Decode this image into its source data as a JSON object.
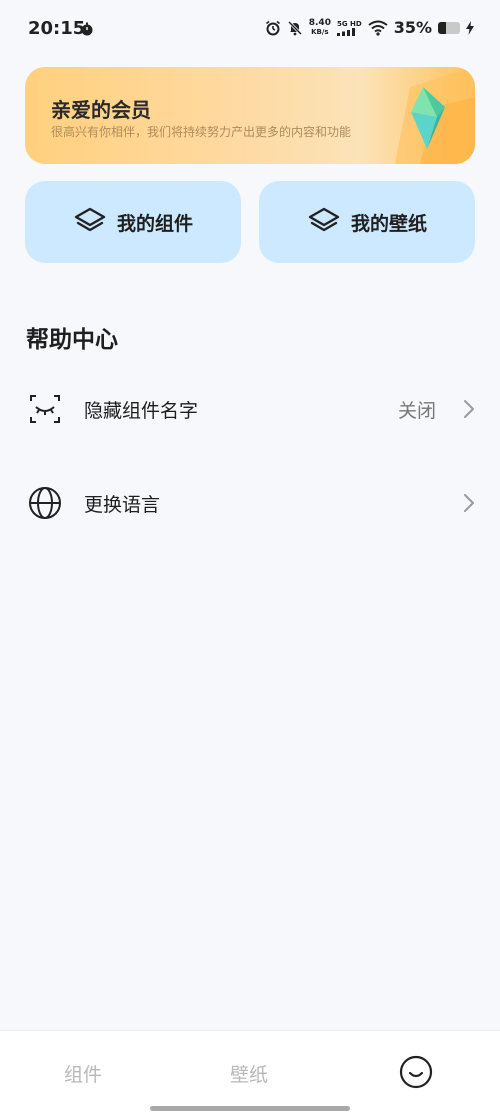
{
  "status_bar": {
    "time": "20:15",
    "net_speed_value": "8.40",
    "net_speed_unit": "KB/s",
    "network_type": "5G HD",
    "battery_text": "35%",
    "battery_level": 0.35
  },
  "banner": {
    "title": "亲爱的会员",
    "subtitle": "很高兴有你相伴，我们将持续努力产出更多的内容和功能"
  },
  "shortcuts": [
    {
      "label": "我的组件",
      "icon": "layers-icon"
    },
    {
      "label": "我的壁纸",
      "icon": "layers-icon"
    }
  ],
  "help_center": {
    "title": "帮助中心",
    "items": [
      {
        "label": "隐藏组件名字",
        "value": "关闭",
        "icon": "eye-closed-icon"
      },
      {
        "label": "更换语言",
        "icon": "globe-icon"
      }
    ]
  },
  "bottom_nav": {
    "items": [
      {
        "label": "组件"
      },
      {
        "label": "壁纸"
      },
      {
        "label": "",
        "icon": "smiley-icon",
        "active": true
      }
    ]
  },
  "colors": {
    "card_bg": "#cde9ff",
    "banner_start": "#ffd07e",
    "page_bg": "#f7f8fb"
  }
}
